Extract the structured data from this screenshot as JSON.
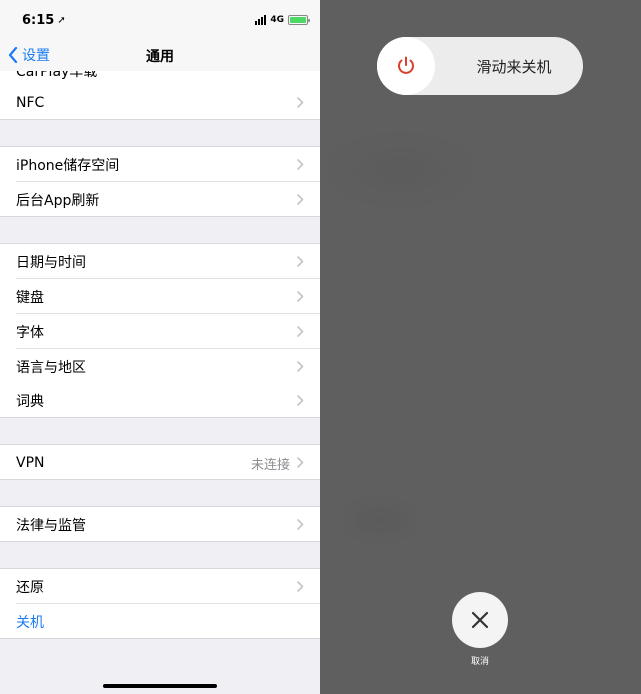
{
  "status": {
    "time": "6:15",
    "network": "4G",
    "accent_battery": "#4cd964"
  },
  "nav": {
    "back_label": "设置",
    "title": "通用"
  },
  "list": {
    "partial_item": "CarPlay车载",
    "nfc": "NFC",
    "storage": "iPhone储存空间",
    "bg_refresh": "后台App刷新",
    "datetime": "日期与时间",
    "keyboard": "键盘",
    "fonts": "字体",
    "language": "语言与地区",
    "dictionary": "词典",
    "vpn": "VPN",
    "vpn_status": "未连接",
    "legal": "法律与监管",
    "reset": "还原",
    "shutdown": "关机"
  },
  "power": {
    "slide_label": "滑动来关机",
    "cancel_label": "取消",
    "power_color": "#d9412f",
    "icons": {
      "power": "power-icon",
      "cancel": "close-icon",
      "chevron": "chevron-right-icon",
      "back": "chevron-left-icon"
    }
  }
}
